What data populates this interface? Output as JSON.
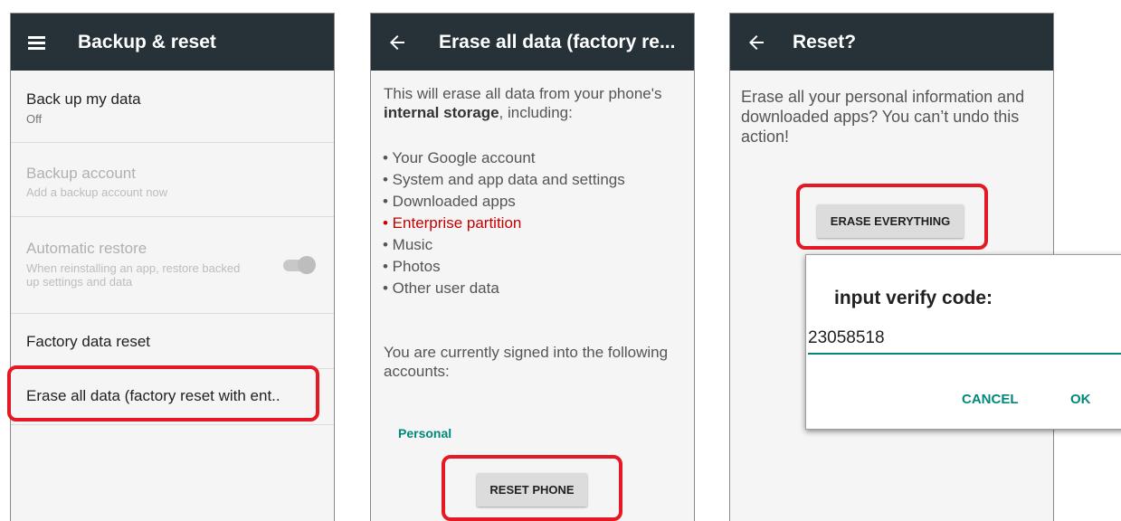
{
  "screen1": {
    "title": "Backup & reset",
    "items": [
      {
        "title": "Back up my data",
        "summary": "Off"
      },
      {
        "title": "Backup account",
        "summary": "Add a backup account now"
      },
      {
        "title": "Automatic restore",
        "summary": "When reinstalling an app, restore backed up settings and data"
      },
      {
        "title": "Factory data reset"
      },
      {
        "title": "Erase all data (factory reset with ent.."
      }
    ],
    "auto_restore_toggle_on": true
  },
  "screen2": {
    "title": "Erase all data (factory re...",
    "intro_prefix": "This will erase all data from your phone's ",
    "intro_bold": "internal storage",
    "intro_suffix": ", including:",
    "bullets": [
      "• Your Google account",
      "• System and app data and settings",
      "• Downloaded apps",
      "• Enterprise partition",
      "• Music",
      "• Photos",
      "• Other user data"
    ],
    "signed_in_text": "You are currently signed into the following accounts:",
    "account_label": "Personal",
    "reset_button": "RESET PHONE"
  },
  "screen3": {
    "title": "Reset?",
    "message": "Erase all your personal information and downloaded apps? You can’t undo this action!",
    "erase_button": "ERASE EVERYTHING"
  },
  "dialog": {
    "title": "input verify code:",
    "code_value": "23058518",
    "cancel": "CANCEL",
    "ok": "OK"
  },
  "colors": {
    "appbar": "#263238",
    "accent": "#00897b",
    "highlight": "#e41923",
    "warning_text": "#c40000"
  }
}
